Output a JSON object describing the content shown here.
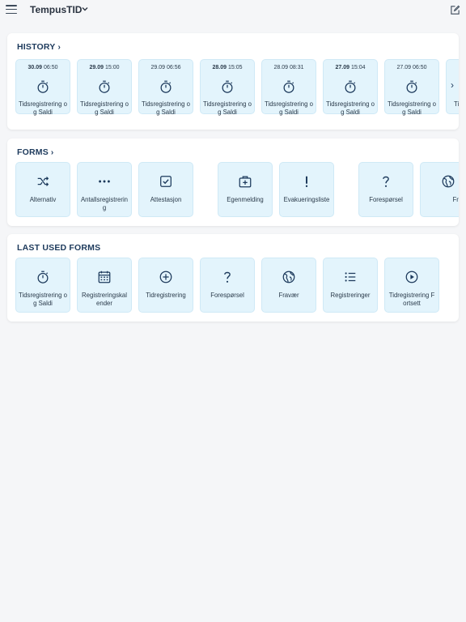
{
  "app": {
    "title": "TempusTID"
  },
  "history": {
    "header": "HISTORY",
    "items": [
      {
        "date": "30.09",
        "time": "06:50",
        "bold": true,
        "label": "Tidsregistrering og Saldi"
      },
      {
        "date": "29.09",
        "time": "15:00",
        "bold": true,
        "label": "Tidsregistrering og Saldi"
      },
      {
        "date": "29.09",
        "time": "06:56",
        "bold": false,
        "label": "Tidsregistrering og Saldi"
      },
      {
        "date": "28.09",
        "time": "15:05",
        "bold": true,
        "label": "Tidsregistrering og Saldi"
      },
      {
        "date": "28.09",
        "time": "08:31",
        "bold": false,
        "label": "Tidsregistrering og Saldi"
      },
      {
        "date": "27.09",
        "time": "15:04",
        "bold": true,
        "label": "Tidsregistrering og Saldi"
      },
      {
        "date": "27.09",
        "time": "06:50",
        "bold": false,
        "label": "Tidsregistrering og Saldi"
      }
    ],
    "partial_label": "Ti"
  },
  "forms": {
    "header": "FORMS",
    "items": [
      {
        "icon": "shuffle-icon",
        "label": "Alternativ"
      },
      {
        "icon": "dots-icon",
        "label": "Antallsregistrering"
      },
      {
        "icon": "checkbox-icon",
        "label": "Attestasjon"
      },
      {
        "icon": "medical-bag-icon",
        "label": "Egenmelding"
      },
      {
        "icon": "exclamation-icon",
        "label": "Evakueringsliste"
      },
      {
        "icon": "question-icon",
        "label": "Forespørsel"
      },
      {
        "icon": "globe-icon",
        "label": "Fravær"
      }
    ]
  },
  "last_used": {
    "header": "LAST USED FORMS",
    "items": [
      {
        "icon": "stopwatch-icon",
        "label": "Tidsregistrering og Saldi"
      },
      {
        "icon": "calendar-icon",
        "label": "Registreringskalender"
      },
      {
        "icon": "plus-circle-icon",
        "label": "Tidregistrering"
      },
      {
        "icon": "question-icon",
        "label": "Forespørsel"
      },
      {
        "icon": "globe-icon",
        "label": "Fravær"
      },
      {
        "icon": "list-icon",
        "label": "Registreringer"
      },
      {
        "icon": "play-circle-icon",
        "label": "Tidregistrering Fortsett"
      }
    ]
  }
}
